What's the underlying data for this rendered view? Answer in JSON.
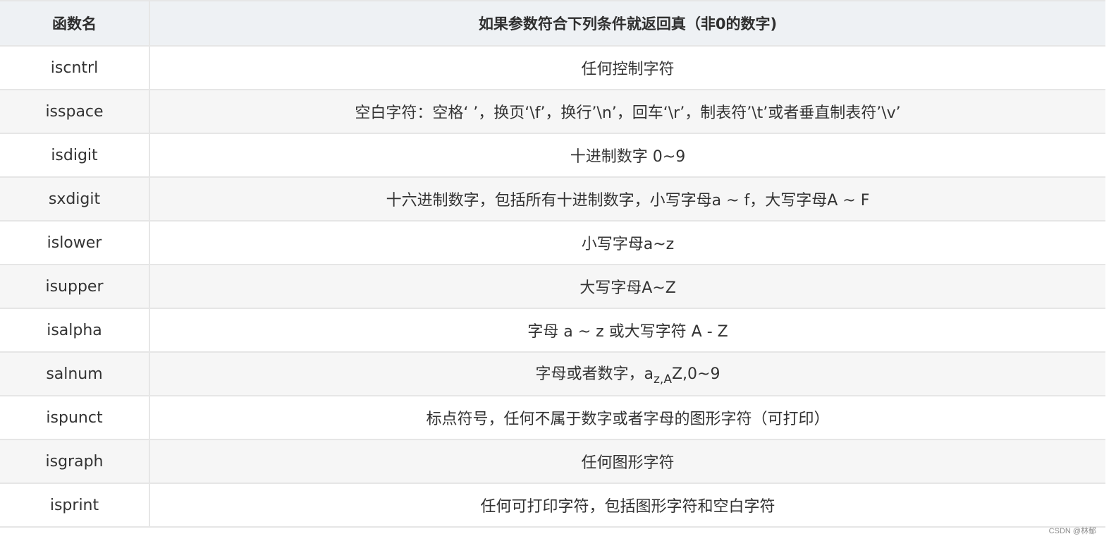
{
  "table": {
    "headers": {
      "function_name": "函数名",
      "condition": "如果参数符合下列条件就返回真（非0的数字)"
    },
    "rows": [
      {
        "name": "iscntrl",
        "condition": "任何控制字符"
      },
      {
        "name": "isspace",
        "condition": "空白字符：空格‘ ’，换页‘\\f’，换行’\\n’，回车‘\\r’，制表符’\\t’或者垂直制表符’\\v’"
      },
      {
        "name": "isdigit",
        "condition": "十进制数字 0~9"
      },
      {
        "name": "sxdigit",
        "condition": "十六进制数字，包括所有十进制数字，小写字母a ~ f，大写字母A ~ F"
      },
      {
        "name": "islower",
        "condition": "小写字母a~z"
      },
      {
        "name": "isupper",
        "condition": "大写字母A~Z"
      },
      {
        "name": "isalpha",
        "condition": "字母 a ~ z 或大写字符 A - Z"
      },
      {
        "name": "salnum",
        "condition_prefix": "字母或者数字，a",
        "condition_sub": "z,A",
        "condition_suffix": "Z,0~9"
      },
      {
        "name": "ispunct",
        "condition": "标点符号，任何不属于数字或者字母的图形字符（可打印）"
      },
      {
        "name": "isgraph",
        "condition": "任何图形字符"
      },
      {
        "name": "isprint",
        "condition": "任何可打印字符，包括图形字符和空白字符"
      }
    ]
  },
  "watermark": "CSDN @林郁"
}
